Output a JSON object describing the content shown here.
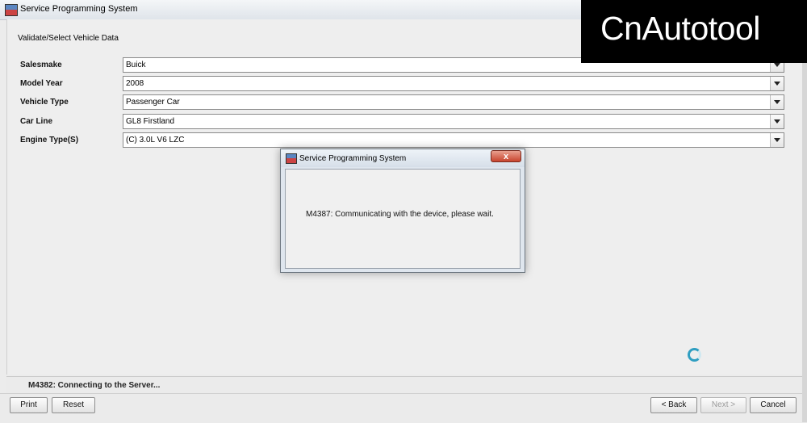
{
  "window": {
    "title": "Service Programming System"
  },
  "content": {
    "heading": "Validate/Select Vehicle Data",
    "fields": [
      {
        "label": "Salesmake",
        "value": "Buick"
      },
      {
        "label": "Model Year",
        "value": "2008"
      },
      {
        "label": "Vehicle Type",
        "value": "Passenger Car"
      },
      {
        "label": "Car Line",
        "value": "GL8 Firstland"
      },
      {
        "label": "Engine Type(S)",
        "value": "(C) 3.0L V6 LZC"
      }
    ]
  },
  "dialog": {
    "title": "Service Programming System",
    "close_label": "x",
    "message": "M4387: Communicating with the device, please wait."
  },
  "status": {
    "text": "M4382: Connecting to the Server..."
  },
  "buttons": {
    "print": "Print",
    "reset": "Reset",
    "back": "< Back",
    "next": "Next >",
    "cancel": "Cancel"
  },
  "watermark": {
    "text": "CnAutotool"
  },
  "icons": {
    "app": "app-icon",
    "dropdown": "chevron-down-icon",
    "spinner": "loading-spinner-icon"
  }
}
